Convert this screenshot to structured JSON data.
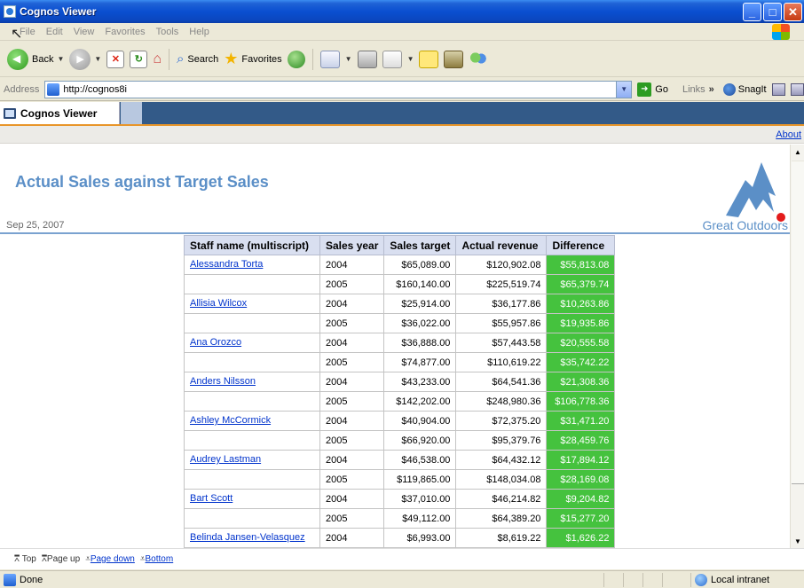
{
  "window": {
    "title": "Cognos Viewer"
  },
  "menubar": {
    "items": [
      "File",
      "Edit",
      "View",
      "Favorites",
      "Tools",
      "Help"
    ]
  },
  "toolbar": {
    "back_label": "Back",
    "search_label": "Search",
    "favorites_label": "Favorites"
  },
  "addressbar": {
    "label": "Address",
    "url": "http://cognos8i",
    "go_label": "Go",
    "links_label": "Links",
    "snagit_label": "SnagIt"
  },
  "viewer": {
    "tab_label": "Cognos Viewer",
    "about_link": "About"
  },
  "report": {
    "title": "Actual Sales against Target Sales",
    "date": "Sep 25, 2007",
    "brand": "Great Outdoors",
    "columns": [
      "Staff name (multiscript)",
      "Sales year",
      "Sales target",
      "Actual revenue",
      "Difference"
    ],
    "staff": [
      {
        "name": "Alessandra Torta",
        "rows": [
          {
            "year": "2004",
            "target": "$65,089.00",
            "revenue": "$120,902.08",
            "difference": "$55,813.08"
          },
          {
            "year": "2005",
            "target": "$160,140.00",
            "revenue": "$225,519.74",
            "difference": "$65,379.74"
          }
        ]
      },
      {
        "name": "Allisia Wilcox",
        "rows": [
          {
            "year": "2004",
            "target": "$25,914.00",
            "revenue": "$36,177.86",
            "difference": "$10,263.86"
          },
          {
            "year": "2005",
            "target": "$36,022.00",
            "revenue": "$55,957.86",
            "difference": "$19,935.86"
          }
        ]
      },
      {
        "name": "Ana Orozco",
        "rows": [
          {
            "year": "2004",
            "target": "$36,888.00",
            "revenue": "$57,443.58",
            "difference": "$20,555.58"
          },
          {
            "year": "2005",
            "target": "$74,877.00",
            "revenue": "$110,619.22",
            "difference": "$35,742.22"
          }
        ]
      },
      {
        "name": "Anders Nilsson",
        "rows": [
          {
            "year": "2004",
            "target": "$43,233.00",
            "revenue": "$64,541.36",
            "difference": "$21,308.36"
          },
          {
            "year": "2005",
            "target": "$142,202.00",
            "revenue": "$248,980.36",
            "difference": "$106,778.36"
          }
        ]
      },
      {
        "name": "Ashley McCormick",
        "rows": [
          {
            "year": "2004",
            "target": "$40,904.00",
            "revenue": "$72,375.20",
            "difference": "$31,471.20"
          },
          {
            "year": "2005",
            "target": "$66,920.00",
            "revenue": "$95,379.76",
            "difference": "$28,459.76"
          }
        ]
      },
      {
        "name": "Audrey Lastman",
        "rows": [
          {
            "year": "2004",
            "target": "$46,538.00",
            "revenue": "$64,432.12",
            "difference": "$17,894.12"
          },
          {
            "year": "2005",
            "target": "$119,865.00",
            "revenue": "$148,034.08",
            "difference": "$28,169.08"
          }
        ]
      },
      {
        "name": "Bart Scott",
        "rows": [
          {
            "year": "2004",
            "target": "$37,010.00",
            "revenue": "$46,214.82",
            "difference": "$9,204.82"
          },
          {
            "year": "2005",
            "target": "$49,112.00",
            "revenue": "$64,389.20",
            "difference": "$15,277.20"
          }
        ]
      },
      {
        "name": "Belinda Jansen-Velasquez",
        "rows": [
          {
            "year": "2004",
            "target": "$6,993.00",
            "revenue": "$8,619.22",
            "difference": "$1,626.22"
          },
          {
            "year": "",
            "target": "",
            "revenue": "",
            "difference": ""
          }
        ]
      }
    ],
    "difference_color": "#45c23e"
  },
  "pagenav": {
    "top": "Top",
    "page_up": "Page up",
    "page_down": "Page down",
    "bottom": "Bottom"
  },
  "statusbar": {
    "status": "Done",
    "zone": "Local intranet"
  }
}
